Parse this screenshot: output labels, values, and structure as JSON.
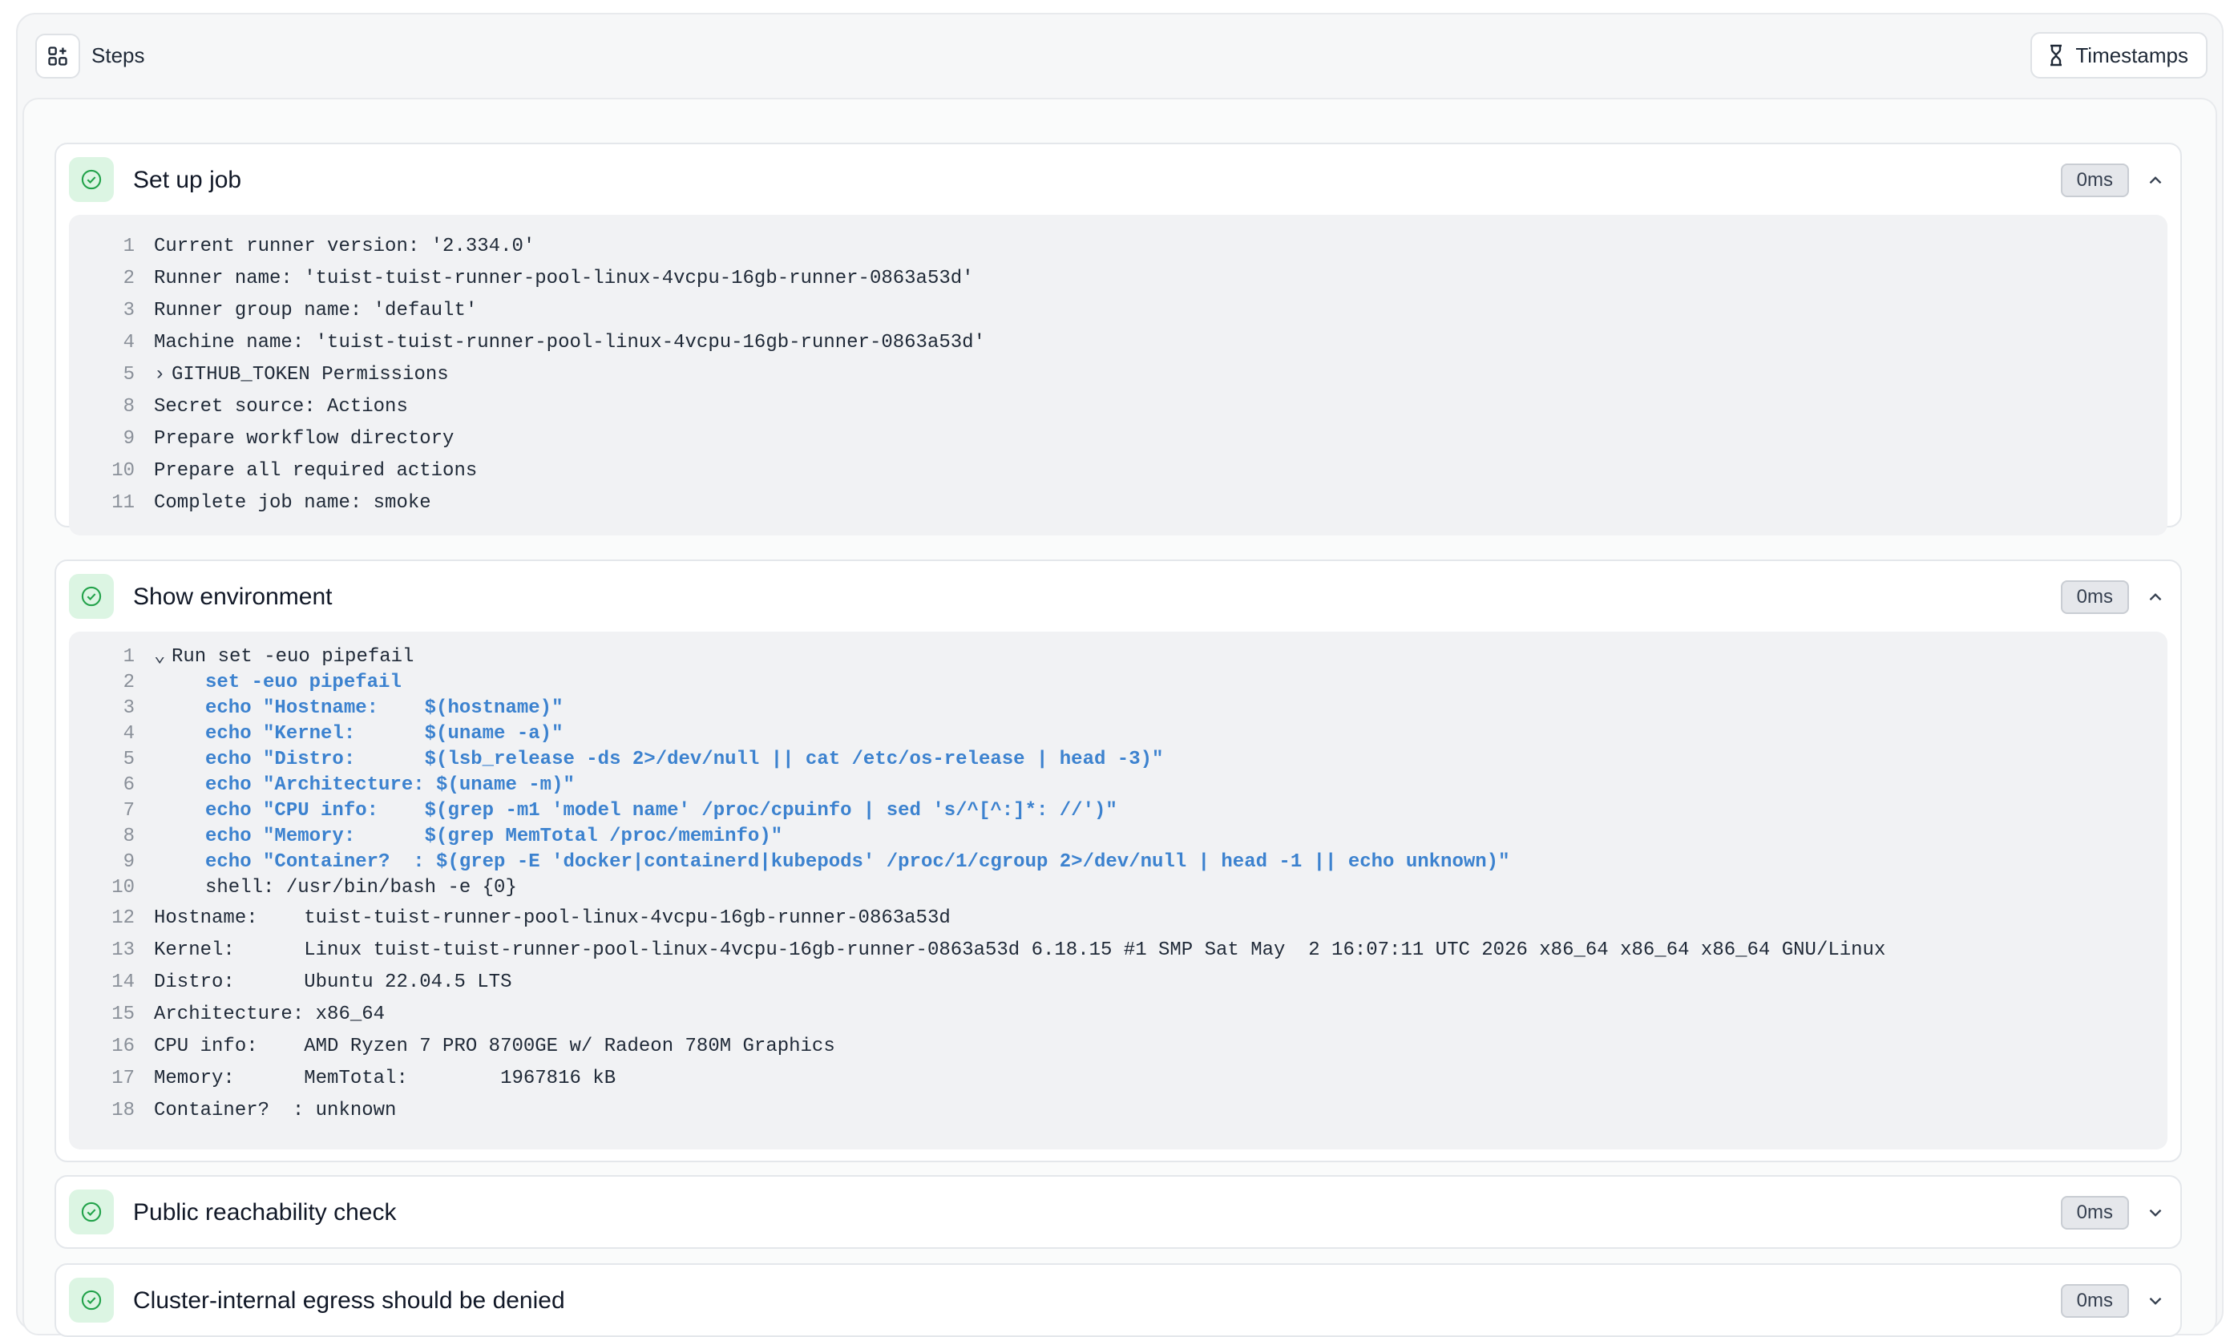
{
  "toolbar": {
    "steps_label": "Steps",
    "timestamps_label": "Timestamps"
  },
  "colors": {
    "success_bg": "#dcf5e3",
    "success_fg": "#22a24a",
    "command_blue": "#3c82cf"
  },
  "steps": [
    {
      "title": "Set up job",
      "duration": "0ms",
      "lines": [
        {
          "n": "1",
          "t": "Current runner version: '2.334.0'"
        },
        {
          "n": "2",
          "t": "Runner name: 'tuist-tuist-runner-pool-linux-4vcpu-16gb-runner-0863a53d'"
        },
        {
          "n": "3",
          "t": "Runner group name: 'default'"
        },
        {
          "n": "4",
          "t": "Machine name: 'tuist-tuist-runner-pool-linux-4vcpu-16gb-runner-0863a53d'"
        },
        {
          "n": "5",
          "t": "GITHUB_TOKEN Permissions",
          "collapsed": true
        },
        {
          "n": "8",
          "t": "Secret source: Actions"
        },
        {
          "n": "9",
          "t": "Prepare workflow directory"
        },
        {
          "n": "10",
          "t": "Prepare all required actions"
        },
        {
          "n": "11",
          "t": "Complete job name: smoke"
        }
      ]
    },
    {
      "title": "Show environment",
      "duration": "0ms",
      "lines": [
        {
          "n": "1",
          "t": "Run set -euo pipefail",
          "expanded": true
        },
        {
          "n": "2",
          "t": "set -euo pipefail",
          "cmd": true
        },
        {
          "n": "3",
          "t": "echo \"Hostname:    $(hostname)\"",
          "cmd": true
        },
        {
          "n": "4",
          "t": "echo \"Kernel:      $(uname -a)\"",
          "cmd": true
        },
        {
          "n": "5",
          "t": "echo \"Distro:      $(lsb_release -ds 2>/dev/null || cat /etc/os-release | head -3)\"",
          "cmd": true
        },
        {
          "n": "6",
          "t": "echo \"Architecture: $(uname -m)\"",
          "cmd": true
        },
        {
          "n": "7",
          "t": "echo \"CPU info:    $(grep -m1 'model name' /proc/cpuinfo | sed 's/^[^:]*: //')\"",
          "cmd": true
        },
        {
          "n": "8",
          "t": "echo \"Memory:      $(grep MemTotal /proc/meminfo)\"",
          "cmd": true
        },
        {
          "n": "9",
          "t": "echo \"Container?  : $(grep -E 'docker|containerd|kubepods' /proc/1/cgroup 2>/dev/null | head -1 || echo unknown)\"",
          "cmd": true
        },
        {
          "n": "10",
          "t": "shell: /usr/bin/bash -e {0}",
          "indent": true
        },
        {
          "n": "12",
          "t": "Hostname:    tuist-tuist-runner-pool-linux-4vcpu-16gb-runner-0863a53d"
        },
        {
          "n": "13",
          "t": "Kernel:      Linux tuist-tuist-runner-pool-linux-4vcpu-16gb-runner-0863a53d 6.18.15 #1 SMP Sat May  2 16:07:11 UTC 2026 x86_64 x86_64 x86_64 GNU/Linux"
        },
        {
          "n": "14",
          "t": "Distro:      Ubuntu 22.04.5 LTS"
        },
        {
          "n": "15",
          "t": "Architecture: x86_64"
        },
        {
          "n": "16",
          "t": "CPU info:    AMD Ryzen 7 PRO 8700GE w/ Radeon 780M Graphics"
        },
        {
          "n": "17",
          "t": "Memory:      MemTotal:        1967816 kB"
        },
        {
          "n": "18",
          "t": "Container?  : unknown"
        }
      ]
    },
    {
      "title": "Public reachability check",
      "duration": "0ms"
    },
    {
      "title": "Cluster-internal egress should be denied",
      "duration": "0ms"
    }
  ]
}
